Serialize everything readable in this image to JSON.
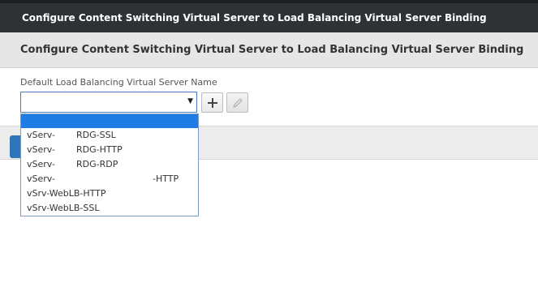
{
  "titlebar": {
    "title": "Configure Content Switching Virtual Server to Load Balancing Virtual Server Binding"
  },
  "heading": {
    "title": "Configure Content Switching Virtual Server to Load Balancing Virtual Server Binding"
  },
  "form": {
    "field_label": "Default Load Balancing Virtual Server Name",
    "selected_value": "",
    "arrow_icon": "dropdown-arrow",
    "add_icon": "plus-icon",
    "edit_icon": "pencil-icon"
  },
  "dropdown": {
    "options": [
      {
        "part1": "",
        "part2": ""
      },
      {
        "part1": "vServ-",
        "part2": "RDG-SSL"
      },
      {
        "part1": "vServ-",
        "part2": "RDG-HTTP"
      },
      {
        "part1": "vServ-",
        "part2": "RDG-RDP"
      },
      {
        "part1": "vServ-",
        "part2": "-HTTP"
      },
      {
        "part1": "vSrv-WebLB-HTTP",
        "part2": ""
      },
      {
        "part1": "vSrv-WebLB-SSL",
        "part2": ""
      }
    ]
  },
  "colors": {
    "titlebar_bg": "#2f3235",
    "selection_blue": "#1e7ce4",
    "button_blue": "#2d76b8"
  }
}
